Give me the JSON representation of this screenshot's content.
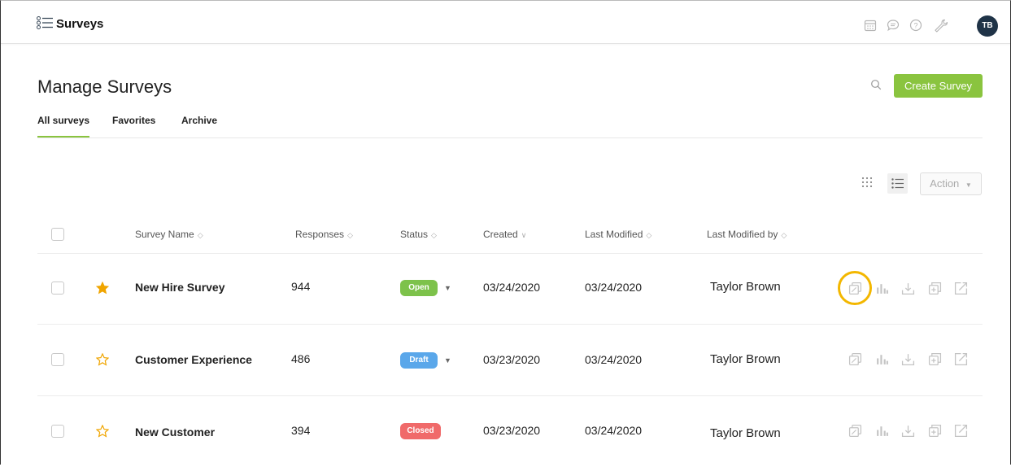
{
  "app": {
    "title": "Surveys",
    "avatar_initials": "TB"
  },
  "page": {
    "title": "Manage Surveys",
    "create_button": "Create Survey",
    "action_button": "Action"
  },
  "tabs": [
    {
      "label": "All surveys",
      "active": true
    },
    {
      "label": "Favorites"
    },
    {
      "label": "Archive"
    }
  ],
  "columns": {
    "name": "Survey Name",
    "responses": "Responses",
    "status": "Status",
    "created": "Created",
    "modified": "Last Modified",
    "modified_by": "Last Modified by"
  },
  "rows": [
    {
      "name": "New Hire Survey",
      "favorite": true,
      "responses": "944",
      "status": "Open",
      "status_color": "#7dc24b",
      "created": "03/24/2020",
      "modified": "03/24/2020",
      "modified_by": "Taylor Brown"
    },
    {
      "name": "Customer Experience",
      "favorite": false,
      "responses": "486",
      "status": "Draft",
      "status_color": "#5aa7ea",
      "created": "03/23/2020",
      "modified": "03/24/2020",
      "modified_by": "Taylor Brown"
    },
    {
      "name": "New Customer",
      "favorite": false,
      "responses": "394",
      "status": "Closed",
      "status_color": "#f06a6a",
      "created": "03/23/2020",
      "modified": "03/24/2020",
      "modified_by": "Taylor Brown"
    }
  ],
  "colors": {
    "accent": "#8ac43f",
    "star": "#f0a500",
    "highlight": "#f3b700"
  },
  "icons": [
    "menu-list-icon",
    "calendar-icon",
    "chat-icon",
    "help-icon",
    "wrench-icon",
    "search-icon",
    "grid-view-icon",
    "list-view-icon",
    "copy-icon",
    "bar-chart-icon",
    "download-icon",
    "add-icon",
    "open-external-icon",
    "star-icon"
  ]
}
